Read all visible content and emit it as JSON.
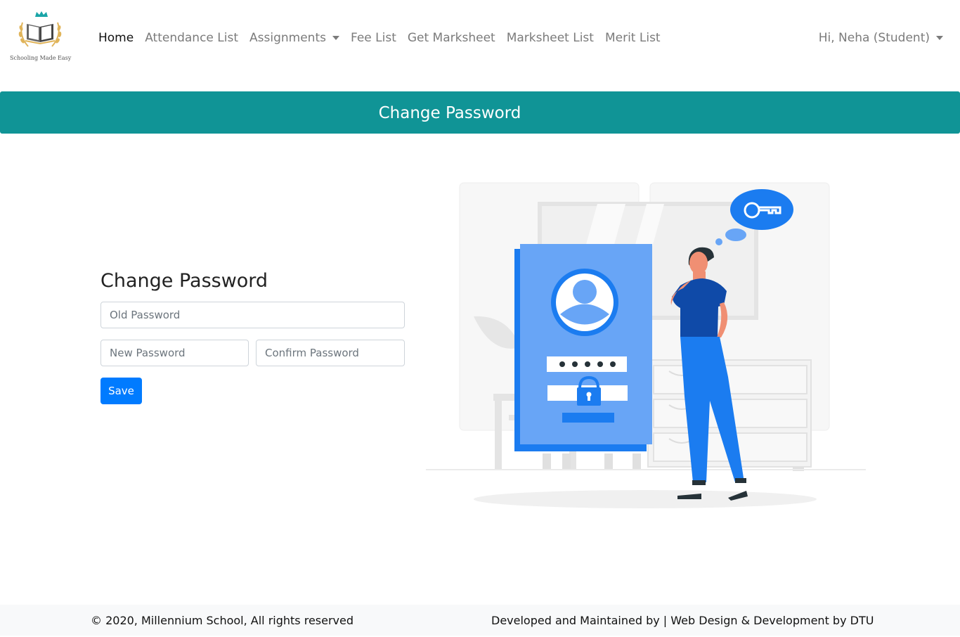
{
  "brand": {
    "tagline": "Schooling Made Easy",
    "colors": {
      "crown": "#1aa5a8",
      "book": "#555555",
      "laurel": "#e0b45a"
    }
  },
  "nav": {
    "items": [
      {
        "label": "Home",
        "active": true
      },
      {
        "label": "Attendance List"
      },
      {
        "label": "Assignments",
        "dropdown": true
      },
      {
        "label": "Fee List"
      },
      {
        "label": "Get Marksheet"
      },
      {
        "label": "Marksheet List"
      },
      {
        "label": "Merit List"
      }
    ],
    "user": "Hi, Neha (Student)"
  },
  "banner": {
    "title": "Change Password",
    "color": "#109496"
  },
  "form": {
    "heading": "Change Password",
    "old_placeholder": "Old Password",
    "new_placeholder": "New Password",
    "confirm_placeholder": "Confirm Password",
    "save_label": "Save",
    "button_color": "#007bff"
  },
  "illustration": {
    "icon": "password-key-illustration",
    "accent": "#1b7cf0"
  },
  "footer": {
    "left": "© 2020, Millennium School, All rights reserved",
    "right": "Developed and Maintained by | Web Design & Development by DTU"
  }
}
